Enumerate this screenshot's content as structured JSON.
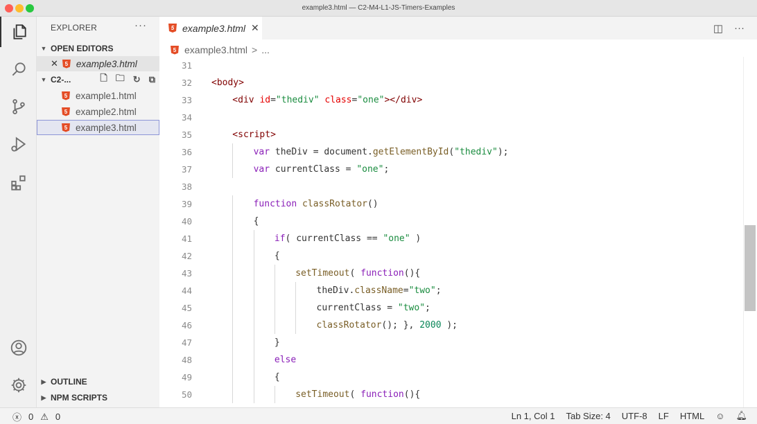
{
  "window": {
    "title": "example3.html — C2-M4-L1-JS-Timers-Examples"
  },
  "activity": [
    "explorer-icon",
    "search-icon",
    "source-control-icon",
    "run-debug-icon",
    "extensions-icon",
    "account-icon",
    "gear-icon"
  ],
  "sidebar": {
    "header": "EXPLORER",
    "more": "···",
    "open_editors_label": "OPEN EDITORS",
    "open_editor": {
      "close": "✕",
      "name": "example3.html"
    },
    "folder_label": "C2-...",
    "files": [
      "example1.html",
      "example2.html",
      "example3.html"
    ],
    "outline_label": "OUTLINE",
    "npm_label": "NPM SCRIPTS"
  },
  "tabs": [
    {
      "label": "example3.html",
      "close": "✕"
    }
  ],
  "breadcrumb": {
    "file": "example3.html",
    "sep": ">",
    "more": "..."
  },
  "code": {
    "lines": [
      {
        "n": "31",
        "indent": 0,
        "tokens": []
      },
      {
        "n": "32",
        "indent": 0,
        "tokens": [
          {
            "t": "<body>",
            "c": "tk-tag"
          }
        ]
      },
      {
        "n": "33",
        "indent": 1,
        "tokens": [
          {
            "t": "<div ",
            "c": "tk-tag"
          },
          {
            "t": "id",
            "c": "tk-attr"
          },
          {
            "t": "=",
            "c": "tk-op"
          },
          {
            "t": "\"thediv\"",
            "c": "tk-str"
          },
          {
            "t": " ",
            "c": "tk-op"
          },
          {
            "t": "class",
            "c": "tk-attr"
          },
          {
            "t": "=",
            "c": "tk-op"
          },
          {
            "t": "\"one\"",
            "c": "tk-str"
          },
          {
            "t": "></div>",
            "c": "tk-tag"
          }
        ]
      },
      {
        "n": "34",
        "indent": 0,
        "tokens": []
      },
      {
        "n": "35",
        "indent": 1,
        "tokens": [
          {
            "t": "<script>",
            "c": "tk-tag"
          }
        ]
      },
      {
        "n": "36",
        "indent": 2,
        "tokens": [
          {
            "t": "var ",
            "c": "tk-kw"
          },
          {
            "t": "theDiv ",
            "c": "tk-op"
          },
          {
            "t": "= ",
            "c": "tk-op"
          },
          {
            "t": "document.",
            "c": "tk-op"
          },
          {
            "t": "getElementById",
            "c": "tk-fn"
          },
          {
            "t": "(",
            "c": "tk-bracket"
          },
          {
            "t": "\"thediv\"",
            "c": "tk-str"
          },
          {
            "t": ");",
            "c": "tk-bracket"
          }
        ]
      },
      {
        "n": "37",
        "indent": 2,
        "tokens": [
          {
            "t": "var ",
            "c": "tk-kw"
          },
          {
            "t": "currentClass ",
            "c": "tk-op"
          },
          {
            "t": "= ",
            "c": "tk-op"
          },
          {
            "t": "\"one\"",
            "c": "tk-str"
          },
          {
            "t": ";",
            "c": "tk-op"
          }
        ]
      },
      {
        "n": "38",
        "indent": 0,
        "tokens": []
      },
      {
        "n": "39",
        "indent": 2,
        "tokens": [
          {
            "t": "function ",
            "c": "tk-kw"
          },
          {
            "t": "classRotator",
            "c": "tk-fn"
          },
          {
            "t": "()",
            "c": "tk-bracket"
          }
        ]
      },
      {
        "n": "40",
        "indent": 2,
        "tokens": [
          {
            "t": "{",
            "c": "tk-bracket"
          }
        ]
      },
      {
        "n": "41",
        "indent": 3,
        "tokens": [
          {
            "t": "if",
            "c": "tk-kw"
          },
          {
            "t": "( ",
            "c": "tk-bracket"
          },
          {
            "t": "currentClass ",
            "c": "tk-op"
          },
          {
            "t": "== ",
            "c": "tk-op"
          },
          {
            "t": "\"one\"",
            "c": "tk-str"
          },
          {
            "t": " )",
            "c": "tk-bracket"
          }
        ]
      },
      {
        "n": "42",
        "indent": 3,
        "tokens": [
          {
            "t": "{",
            "c": "tk-bracket"
          }
        ]
      },
      {
        "n": "43",
        "indent": 4,
        "tokens": [
          {
            "t": "setTimeout",
            "c": "tk-fn"
          },
          {
            "t": "( ",
            "c": "tk-bracket"
          },
          {
            "t": "function",
            "c": "tk-kw"
          },
          {
            "t": "(){",
            "c": "tk-bracket"
          }
        ]
      },
      {
        "n": "44",
        "indent": 5,
        "tokens": [
          {
            "t": "theDiv.",
            "c": "tk-op"
          },
          {
            "t": "className",
            "c": "tk-fn"
          },
          {
            "t": "=",
            "c": "tk-op"
          },
          {
            "t": "\"two\"",
            "c": "tk-str"
          },
          {
            "t": ";",
            "c": "tk-op"
          }
        ]
      },
      {
        "n": "45",
        "indent": 5,
        "tokens": [
          {
            "t": "currentClass ",
            "c": "tk-op"
          },
          {
            "t": "= ",
            "c": "tk-op"
          },
          {
            "t": "\"two\"",
            "c": "tk-str"
          },
          {
            "t": ";",
            "c": "tk-op"
          }
        ]
      },
      {
        "n": "46",
        "indent": 5,
        "tokens": [
          {
            "t": "classRotator",
            "c": "tk-fn"
          },
          {
            "t": "(); }, ",
            "c": "tk-bracket"
          },
          {
            "t": "2000",
            "c": "tk-num"
          },
          {
            "t": " );",
            "c": "tk-bracket"
          }
        ]
      },
      {
        "n": "47",
        "indent": 3,
        "tokens": [
          {
            "t": "}",
            "c": "tk-bracket"
          }
        ]
      },
      {
        "n": "48",
        "indent": 3,
        "tokens": [
          {
            "t": "else",
            "c": "tk-kw"
          }
        ]
      },
      {
        "n": "49",
        "indent": 3,
        "tokens": [
          {
            "t": "{",
            "c": "tk-bracket"
          }
        ]
      },
      {
        "n": "50",
        "indent": 4,
        "tokens": [
          {
            "t": "setTimeout",
            "c": "tk-fn"
          },
          {
            "t": "( ",
            "c": "tk-bracket"
          },
          {
            "t": "function",
            "c": "tk-kw"
          },
          {
            "t": "(){",
            "c": "tk-bracket"
          }
        ]
      }
    ]
  },
  "status": {
    "errors": "0",
    "warnings": "0",
    "position": "Ln 1, Col 1",
    "tab_size": "Tab Size: 4",
    "encoding": "UTF-8",
    "eol": "LF",
    "language": "HTML"
  }
}
